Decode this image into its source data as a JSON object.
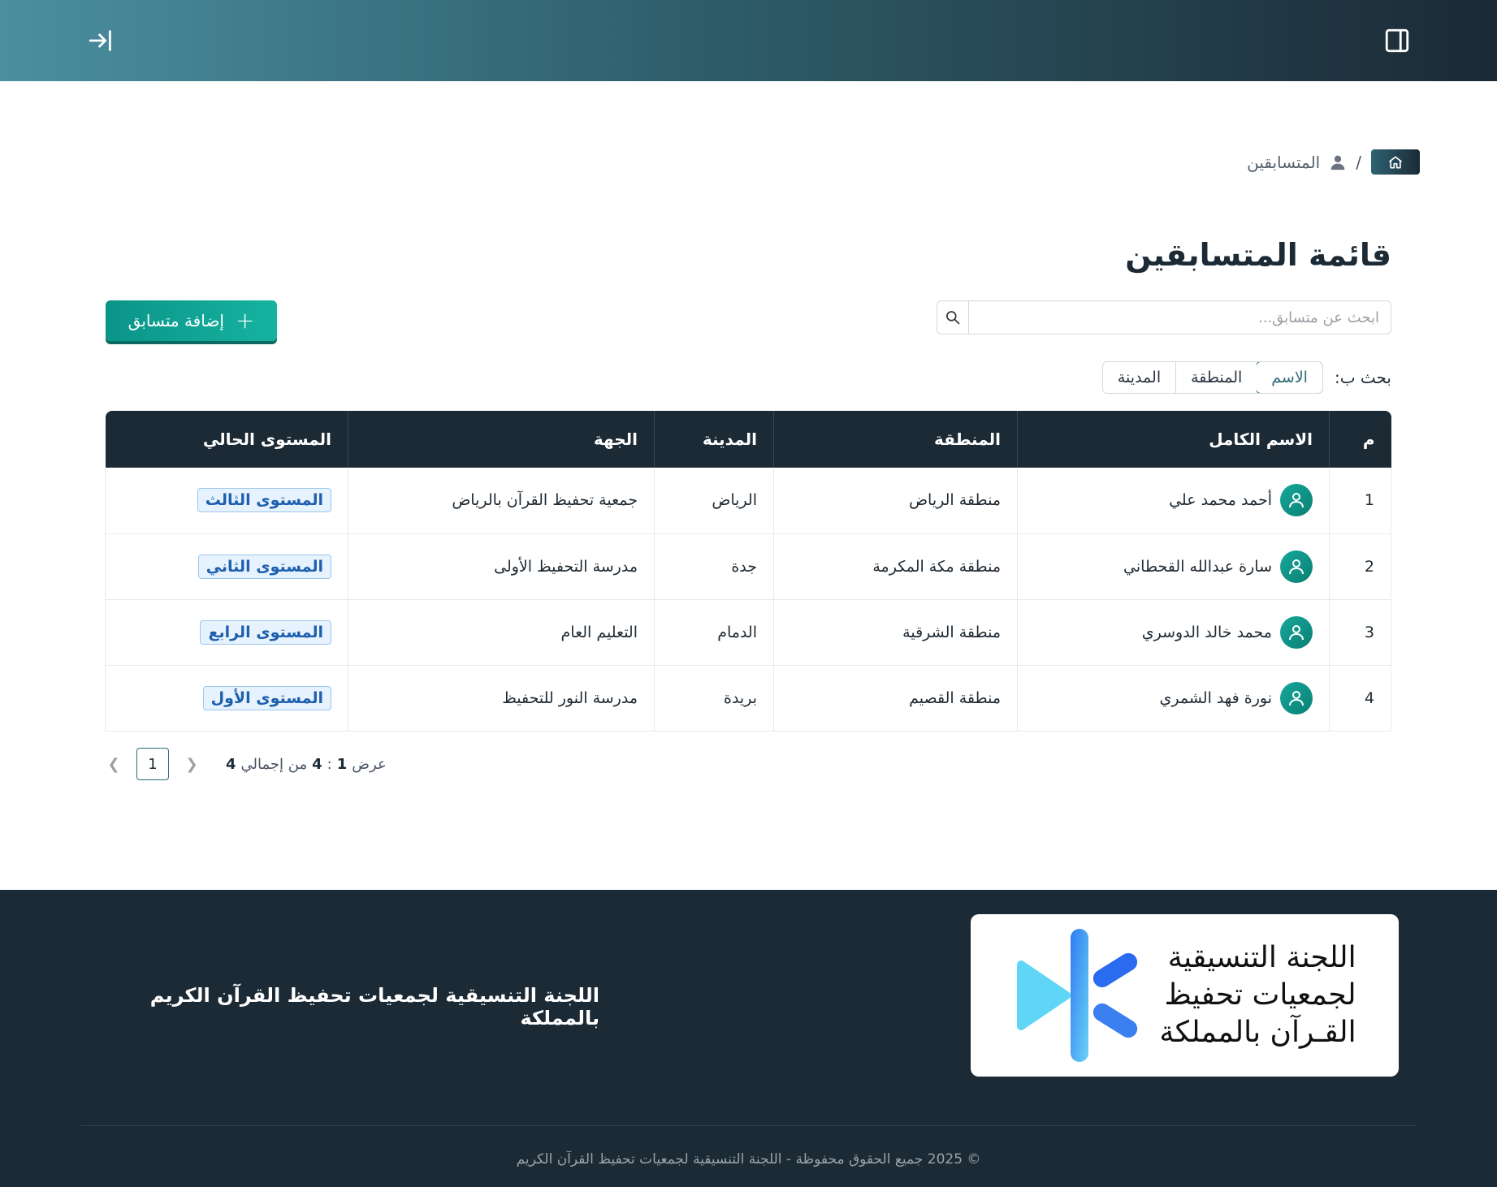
{
  "header": {
    "logout_icon": "login-arrow-icon",
    "sidebar_icon": "sidebar-panel-icon"
  },
  "breadcrumb": {
    "home_icon": "home-icon",
    "separator": "/",
    "current_icon": "user-icon",
    "current_label": "المتسابقين"
  },
  "page": {
    "title": "قائمة المتسابقين"
  },
  "search": {
    "placeholder": "ابحث عن متسابق...",
    "value": ""
  },
  "add_button": {
    "label": "إضافة متسابق",
    "icon": "plus-icon"
  },
  "search_by": {
    "label": "بحث ب:",
    "options": [
      "الاسم",
      "المنطقة",
      "المدينة"
    ],
    "selected": "الاسم"
  },
  "table": {
    "columns": [
      "م",
      "الاسم الكامل",
      "المنطقة",
      "المدينة",
      "الجهة",
      "المستوى الحالي"
    ],
    "rows": [
      {
        "index": "1",
        "name": "أحمد محمد علي",
        "region": "منطقة الرياض",
        "city": "الرياض",
        "entity": "جمعية تحفيظ القرآن بالرياض",
        "level": "المستوى الثالث"
      },
      {
        "index": "2",
        "name": "سارة عبدالله القحطاني",
        "region": "منطقة مكة المكرمة",
        "city": "جدة",
        "entity": "مدرسة التحفيظ الأولى",
        "level": "المستوى الثاني"
      },
      {
        "index": "3",
        "name": "محمد خالد الدوسري",
        "region": "منطقة الشرقية",
        "city": "الدمام",
        "entity": "التعليم العام",
        "level": "المستوى الرابع"
      },
      {
        "index": "4",
        "name": "نورة فهد الشمري",
        "region": "منطقة القصيم",
        "city": "بريدة",
        "entity": "مدرسة النور للتحفيظ",
        "level": "المستوى الأول"
      }
    ]
  },
  "pagination": {
    "show_label": "عرض",
    "from": "1",
    "separator": ":",
    "to": "4",
    "of_label": "من إجمالي",
    "total": "4",
    "current_page": "1",
    "prev_icon": "chevron-left-icon",
    "next_icon": "chevron-right-icon"
  },
  "footer": {
    "logo_lines": [
      "اللجنة التنسيقية",
      "لجمعيات تحفيظ",
      "القـرآن بالمملكة"
    ],
    "heading": "اللجنة التنسيقية لجمعيات تحفيظ القرآن الكريم بالمملكة",
    "copyright": "© 2025 جميع الحقوق محفوظة - اللجنة التنسيقية لجمعيات تحفيظ القرآن الكريم"
  },
  "colors": {
    "primary_dark": "#1b2a35",
    "accent_teal": "#0a9488",
    "badge_blue": "#1d5fae"
  }
}
